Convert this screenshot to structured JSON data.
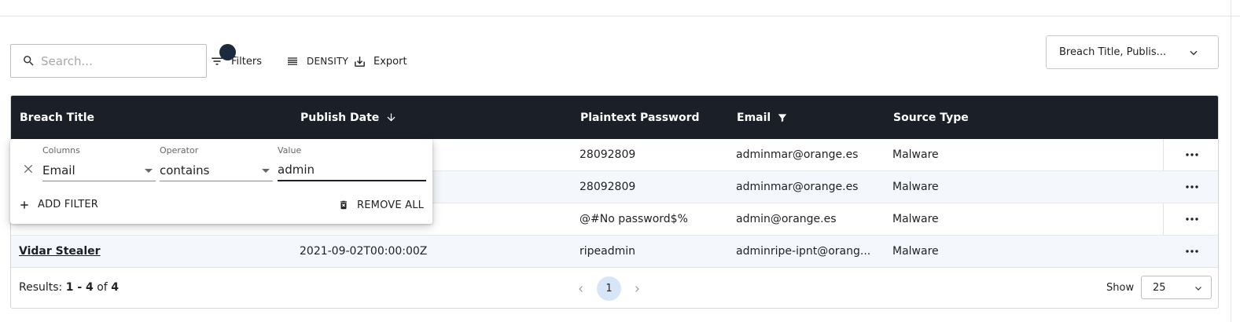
{
  "toolbar": {
    "search_placeholder": "Search...",
    "filters_label": "Filters",
    "density_label": "DENSITY",
    "export_label": "Export",
    "columns_select_value": "Breach Title, Publis..."
  },
  "table": {
    "headers": [
      "Breach Title",
      "Publish Date",
      "Plaintext Password",
      "Email",
      "Source Type"
    ],
    "rows": [
      {
        "title": "",
        "date": "",
        "password": "28092809",
        "email": "adminmar@orange.es",
        "source": "Malware"
      },
      {
        "title": "",
        "date": "",
        "password": "28092809",
        "email": "adminmar@orange.es",
        "source": "Malware"
      },
      {
        "title": "",
        "date": "",
        "password": "@#No password$%",
        "email": "admin@orange.es",
        "source": "Malware"
      },
      {
        "title": "Vidar Stealer",
        "date": "2021-09-02T00:00:00Z",
        "password": "ripeadmin",
        "email": "adminripe-ipnt@orang...",
        "source": "Malware"
      }
    ]
  },
  "footer": {
    "results_prefix": "Results:",
    "results_range": "1 - 4",
    "results_of": "of",
    "results_total": "4",
    "current_page": "1",
    "show_label": "Show",
    "page_size": "25"
  },
  "filter_panel": {
    "columns_label": "Columns",
    "columns_value": "Email",
    "operator_label": "Operator",
    "operator_value": "contains",
    "value_label": "Value",
    "value_value": "admin",
    "add_filter_label": "ADD FILTER",
    "remove_all_label": "REMOVE ALL"
  },
  "colors": {
    "header_bg": "#1b1f27",
    "row_alt_bg": "#f4f7fb",
    "page_active_bg": "#d6e6f7"
  }
}
